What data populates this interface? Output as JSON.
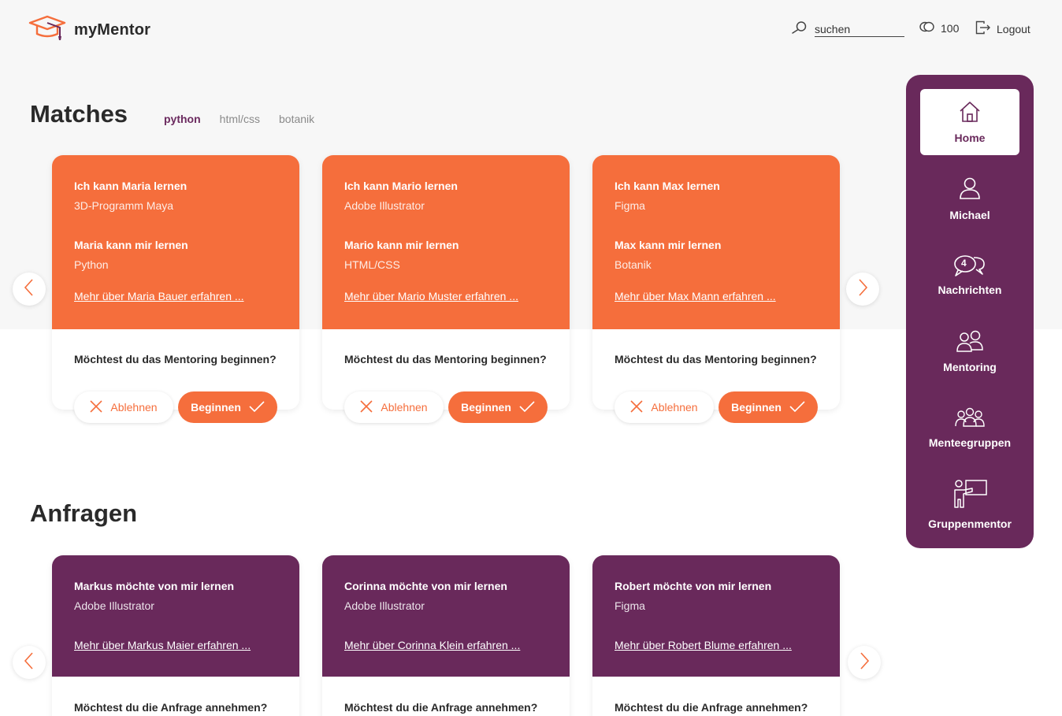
{
  "header": {
    "brand": "myMentor",
    "search_placeholder": "suchen",
    "coins": "100",
    "logout_label": "Logout"
  },
  "matches": {
    "title": "Matches",
    "tabs": [
      {
        "label": "python",
        "active": true
      },
      {
        "label": "html/css",
        "active": false
      },
      {
        "label": "botanik",
        "active": false
      }
    ],
    "cards": [
      {
        "i_can_learn": "Ich kann Maria lernen",
        "i_can_learn_topic": "3D-Programm Maya",
        "they_can_learn": "Maria kann mir lernen",
        "they_can_learn_topic": "Python",
        "more_link": "Mehr über Maria Bauer erfahren ...",
        "question": "Möchtest du das Mentoring beginnen?",
        "decline_label": "Ablehnen",
        "start_label": "Beginnen"
      },
      {
        "i_can_learn": "Ich kann Mario lernen",
        "i_can_learn_topic": "Adobe Illustrator",
        "they_can_learn": "Mario kann mir lernen",
        "they_can_learn_topic": "HTML/CSS",
        "more_link": "Mehr über Mario Muster erfahren ...",
        "question": "Möchtest du das Mentoring beginnen?",
        "decline_label": "Ablehnen",
        "start_label": "Beginnen"
      },
      {
        "i_can_learn": "Ich kann Max lernen",
        "i_can_learn_topic": "Figma",
        "they_can_learn": "Max kann mir lernen",
        "they_can_learn_topic": "Botanik",
        "more_link": "Mehr über Max Mann erfahren ...",
        "question": "Möchtest du das Mentoring beginnen?",
        "decline_label": "Ablehnen",
        "start_label": "Beginnen"
      }
    ]
  },
  "requests": {
    "title": "Anfragen",
    "cards": [
      {
        "headline": "Markus möchte von mir lernen",
        "topic": "Adobe Illustrator",
        "more_link": "Mehr über Markus Maier erfahren ...",
        "question": "Möchtest du die Anfrage annehmen?"
      },
      {
        "headline": "Corinna möchte von mir lernen",
        "topic": "Adobe Illustrator",
        "more_link": "Mehr über Corinna Klein erfahren ...",
        "question": "Möchtest du die Anfrage annehmen?"
      },
      {
        "headline": "Robert möchte von mir lernen",
        "topic": "Figma",
        "more_link": "Mehr über Robert Blume erfahren ...",
        "question": "Möchtest du die Anfrage annehmen?"
      }
    ]
  },
  "sidenav": {
    "items": [
      {
        "label": "Home",
        "icon": "home-icon",
        "active": true
      },
      {
        "label": "Michael",
        "icon": "user-icon",
        "active": false
      },
      {
        "label": "Nachrichten",
        "icon": "messages-icon",
        "badge": "4",
        "active": false
      },
      {
        "label": "Mentoring",
        "icon": "pair-icon",
        "active": false
      },
      {
        "label": "Menteegruppen",
        "icon": "group-icon",
        "active": false
      },
      {
        "label": "Gruppenmentor",
        "icon": "presenter-icon",
        "active": false
      }
    ]
  },
  "colors": {
    "orange": "#f56e3c",
    "purple": "#69295b"
  }
}
